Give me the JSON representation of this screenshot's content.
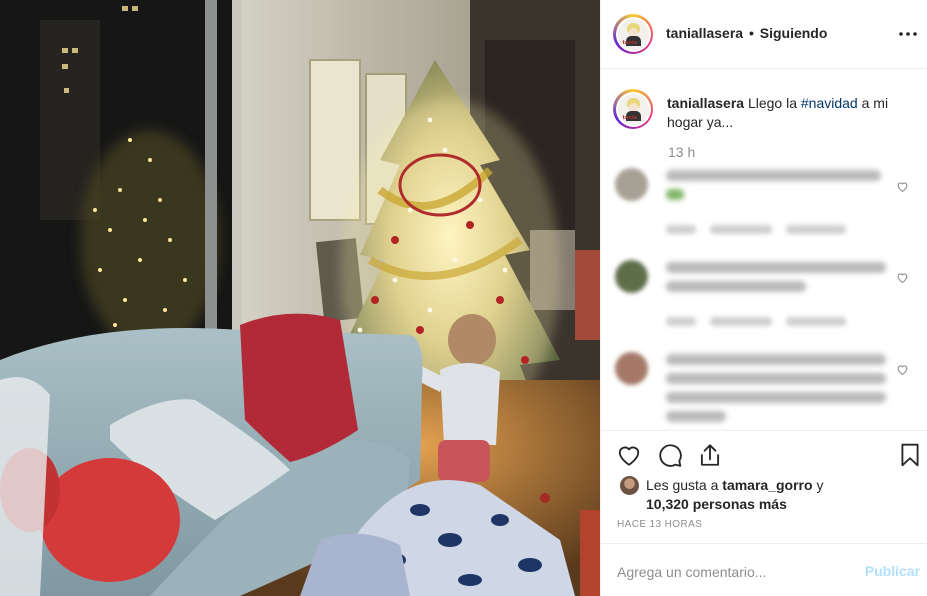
{
  "post": {
    "username": "taniallasera",
    "separator": "•",
    "follow_status": "Siguiendo",
    "avatar_tag": "tania"
  },
  "caption": {
    "username": "taniallasera",
    "text_before": "Llego la",
    "hashtag": "#navidad",
    "text_after": "a mi hogar ya...",
    "time": "13 h"
  },
  "blurred_comments_count": 3,
  "likes": {
    "prefix": "Les gusta a",
    "user": "tamara_gorro",
    "joiner": "y",
    "count_text": "10,320 personas más"
  },
  "timestamp": "HACE 13 HORAS",
  "comment_box": {
    "placeholder": "Agrega un comentario...",
    "publish_label": "Publicar"
  },
  "icons": {
    "more": "more-horizontal-icon",
    "like": "heart-icon",
    "comment": "comment-bubble-icon",
    "share": "share-icon",
    "save": "bookmark-icon",
    "comment_like": "heart-outline-icon"
  },
  "colors": {
    "link": "#003569",
    "muted": "#8e8e8e",
    "publish_disabled": "#b2dffc",
    "divider": "#efefef"
  }
}
